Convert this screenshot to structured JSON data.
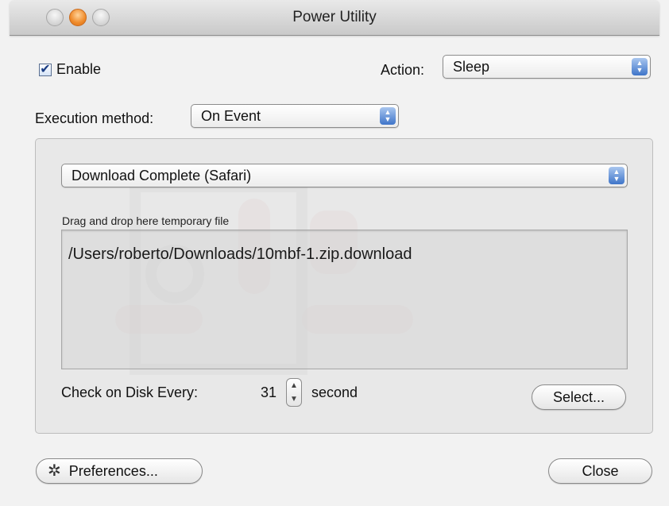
{
  "window": {
    "title": "Power Utility"
  },
  "enable": {
    "label": "Enable",
    "checked": true,
    "check_glyph": "✔"
  },
  "action": {
    "label": "Action:",
    "selected": "Sleep"
  },
  "execution": {
    "label": "Execution method:",
    "selected": "On Event"
  },
  "event": {
    "selected": "Download Complete (Safari)"
  },
  "drop_area": {
    "label": "Drag and drop here temporary file",
    "path": "/Users/roberto/Downloads/10mbf-1.zip.download"
  },
  "check_disk": {
    "label": "Check on Disk Every:",
    "value": "31",
    "unit": "second"
  },
  "buttons": {
    "select": "Select...",
    "preferences": "Preferences...",
    "close": "Close"
  },
  "icons": {
    "popup_arrows": "up-down-arrows-icon",
    "gear": "gear-icon"
  },
  "colors": {
    "accent_blue": "#3f75c9",
    "close_button_orange": "#ef8a29"
  }
}
